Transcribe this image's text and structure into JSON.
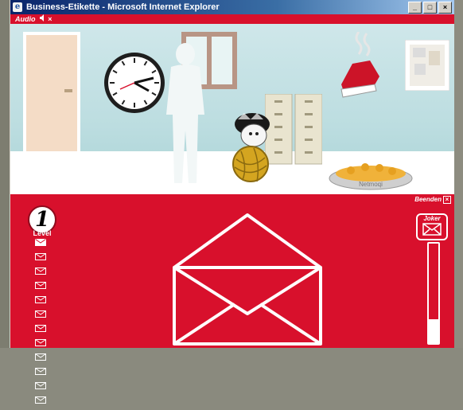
{
  "window": {
    "title": "Business-Etikette - Microsoft Internet Explorer",
    "icon": "ie-icon",
    "minimize_label": "_",
    "maximize_label": "□",
    "close_label": "×"
  },
  "audio": {
    "label": "Audio",
    "speaker_icon": "speaker-icon",
    "mute_label": "×"
  },
  "scene": {
    "icons": [
      "door",
      "clock",
      "silhouette",
      "filing-cabinet",
      "mascot",
      "yarn-ball",
      "sneaker",
      "pinboard",
      "bowl"
    ],
    "bowl_label": "Netmoqi"
  },
  "exit": {
    "label": "Beenden",
    "close_label": "×"
  },
  "level": {
    "number": "1",
    "label": "Level",
    "envelope_count": 12,
    "completed": 1
  },
  "joker": {
    "label": "Joker",
    "icon": "envelope-icon",
    "level": 0.24
  },
  "main": {
    "icon": "large-envelope-icon"
  },
  "colors": {
    "brand_red": "#d8102c",
    "titlebar": "#0a246a",
    "white": "#ffffff"
  }
}
